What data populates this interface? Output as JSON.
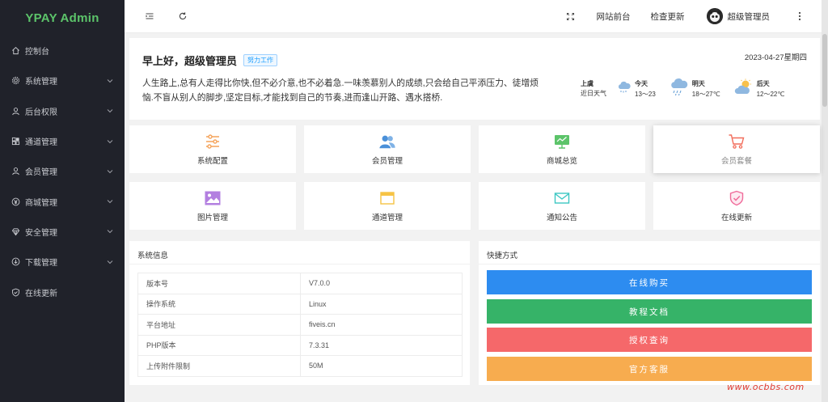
{
  "brand": "YPAY Admin",
  "sidebar": {
    "items": [
      {
        "label": "控制台",
        "icon": "home-icon",
        "chevron": false
      },
      {
        "label": "系统管理",
        "icon": "gear-icon",
        "chevron": true
      },
      {
        "label": "后台权限",
        "icon": "user-icon",
        "chevron": true
      },
      {
        "label": "通道管理",
        "icon": "grid-icon",
        "chevron": true
      },
      {
        "label": "会员管理",
        "icon": "user-icon",
        "chevron": true
      },
      {
        "label": "商城管理",
        "icon": "yen-icon",
        "chevron": true
      },
      {
        "label": "安全管理",
        "icon": "diamond-icon",
        "chevron": true
      },
      {
        "label": "下载管理",
        "icon": "download-icon",
        "chevron": true
      },
      {
        "label": "在线更新",
        "icon": "shield-check-icon",
        "chevron": false
      }
    ]
  },
  "header": {
    "site_front": "网站前台",
    "check_update": "检查更新",
    "username": "超级管理员",
    "icons": [
      "menu-fold-icon",
      "refresh-icon",
      "fullscreen-icon",
      "more-vertical-icon"
    ]
  },
  "welcome": {
    "greeting": "早上好，超级管理员",
    "tag": "努力工作",
    "date": "2023-04-27星期四",
    "quote": "人生路上,总有人走得比你快,但不必介意,也不必着急.一味羡慕别人的成绩,只会给自己平添压力、徒增烦恼.不盲从别人的脚步,坚定目标,才能找到自己的节奏,进而逢山开路、遇水搭桥."
  },
  "weather": {
    "location": "上虞",
    "location_sub": "近日天气",
    "days": [
      {
        "name": "今天",
        "temp": "13～23",
        "icon": "light-rain-icon"
      },
      {
        "name": "明天",
        "temp": "18～27℃",
        "icon": "heavy-rain-icon"
      },
      {
        "name": "后天",
        "temp": "12～22℃",
        "icon": "partly-cloudy-icon"
      }
    ]
  },
  "tiles": [
    {
      "label": "系统配置",
      "icon": "sliders-icon",
      "color": "#f5a35a"
    },
    {
      "label": "会员管理",
      "icon": "users-icon",
      "color": "#4a90d9"
    },
    {
      "label": "商城总览",
      "icon": "chart-board-icon",
      "color": "#5cc46a"
    },
    {
      "label": "会员套餐",
      "icon": "cart-icon",
      "color": "#f26d5b"
    },
    {
      "label": "图片管理",
      "icon": "image-icon",
      "color": "#b37fe0"
    },
    {
      "label": "通道管理",
      "icon": "window-icon",
      "color": "#f6c344"
    },
    {
      "label": "通知公告",
      "icon": "mail-icon",
      "color": "#3dc7c3"
    },
    {
      "label": "在线更新",
      "icon": "shield-check-icon",
      "color": "#f06b9a"
    }
  ],
  "system_info": {
    "title": "系统信息",
    "rows": [
      {
        "key": "版本号",
        "value": "V7.0.0"
      },
      {
        "key": "操作系统",
        "value": "Linux"
      },
      {
        "key": "平台地址",
        "value": "fiveis.cn"
      },
      {
        "key": "PHP版本",
        "value": "7.3.31"
      },
      {
        "key": "上传附件限制",
        "value": "50M"
      }
    ]
  },
  "shortcuts": {
    "title": "快捷方式",
    "buttons": [
      {
        "label": "在线购买",
        "color": "#2d8cf0"
      },
      {
        "label": "教程文档",
        "color": "#36b368"
      },
      {
        "label": "授权查询",
        "color": "#f5686a"
      },
      {
        "label": "官方客服",
        "color": "#f7ac4f"
      }
    ]
  },
  "watermark": "www.ocbbs.com"
}
